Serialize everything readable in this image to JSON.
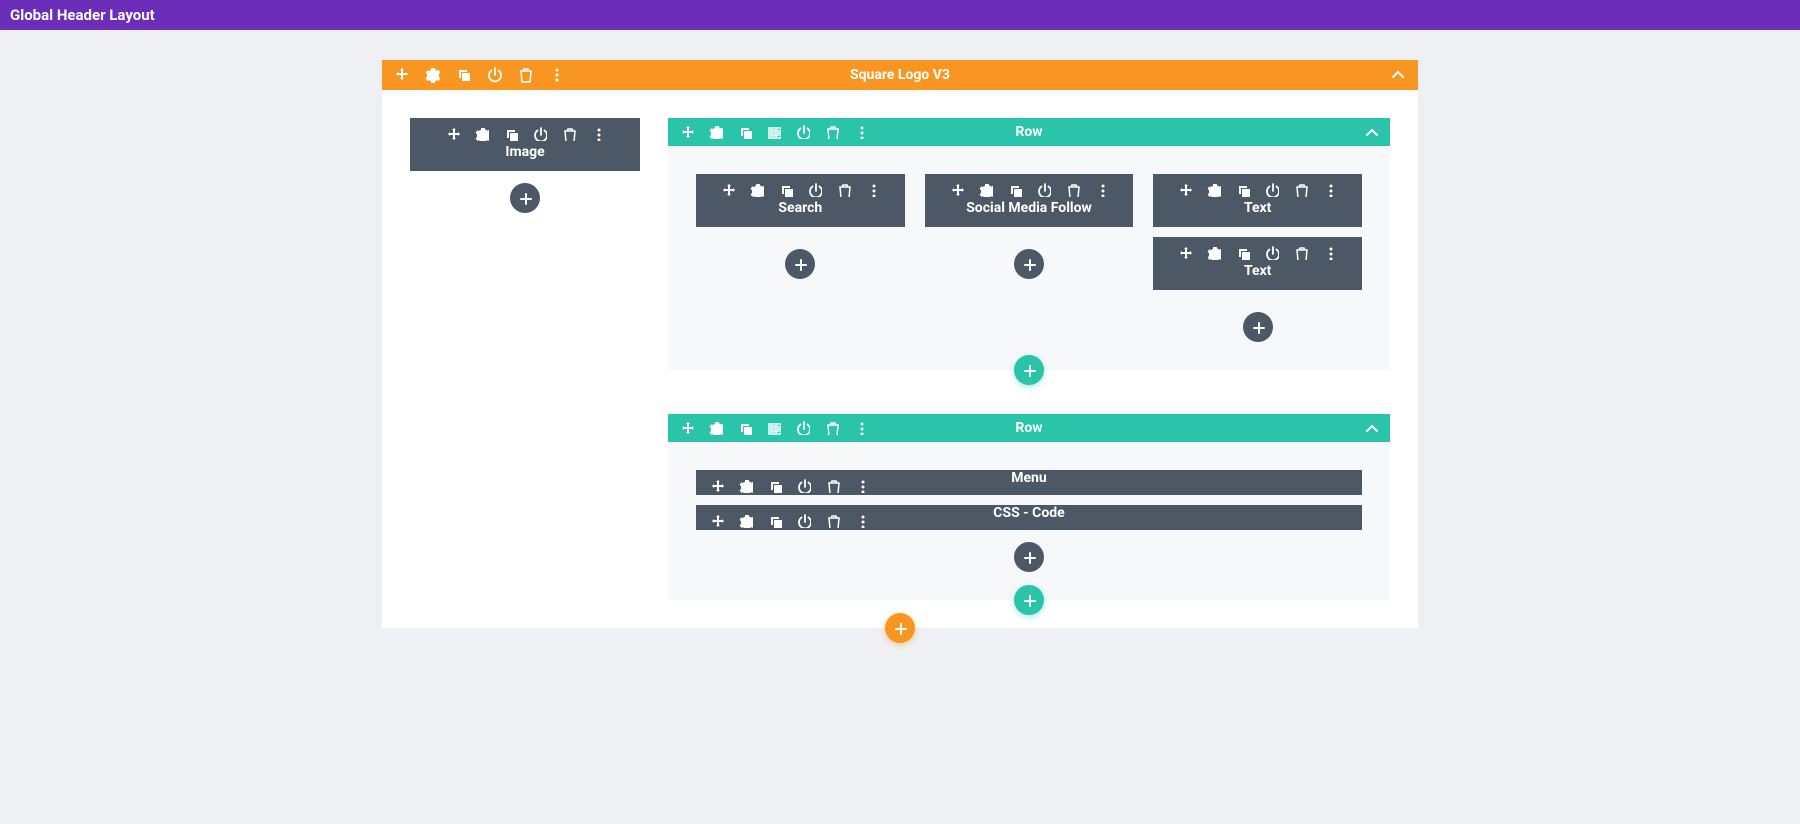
{
  "page": {
    "banner_title": "Global Header Layout"
  },
  "section": {
    "title": "Square Logo V3"
  },
  "col_left": {
    "module_image": "Image"
  },
  "row1": {
    "title": "Row",
    "cols": {
      "search": "Search",
      "social": "Social Media Follow",
      "text1": "Text",
      "text2": "Text"
    }
  },
  "row2": {
    "title": "Row",
    "menu": "Menu",
    "css_code": "CSS - Code"
  },
  "icons": {
    "move": "move-icon",
    "settings": "gear-icon",
    "duplicate": "duplicate-icon",
    "columns": "columns-icon",
    "power": "power-icon",
    "trash": "trash-icon",
    "more": "more-vertical-icon",
    "collapse": "chevron-up-icon",
    "plus": "plus-icon"
  }
}
